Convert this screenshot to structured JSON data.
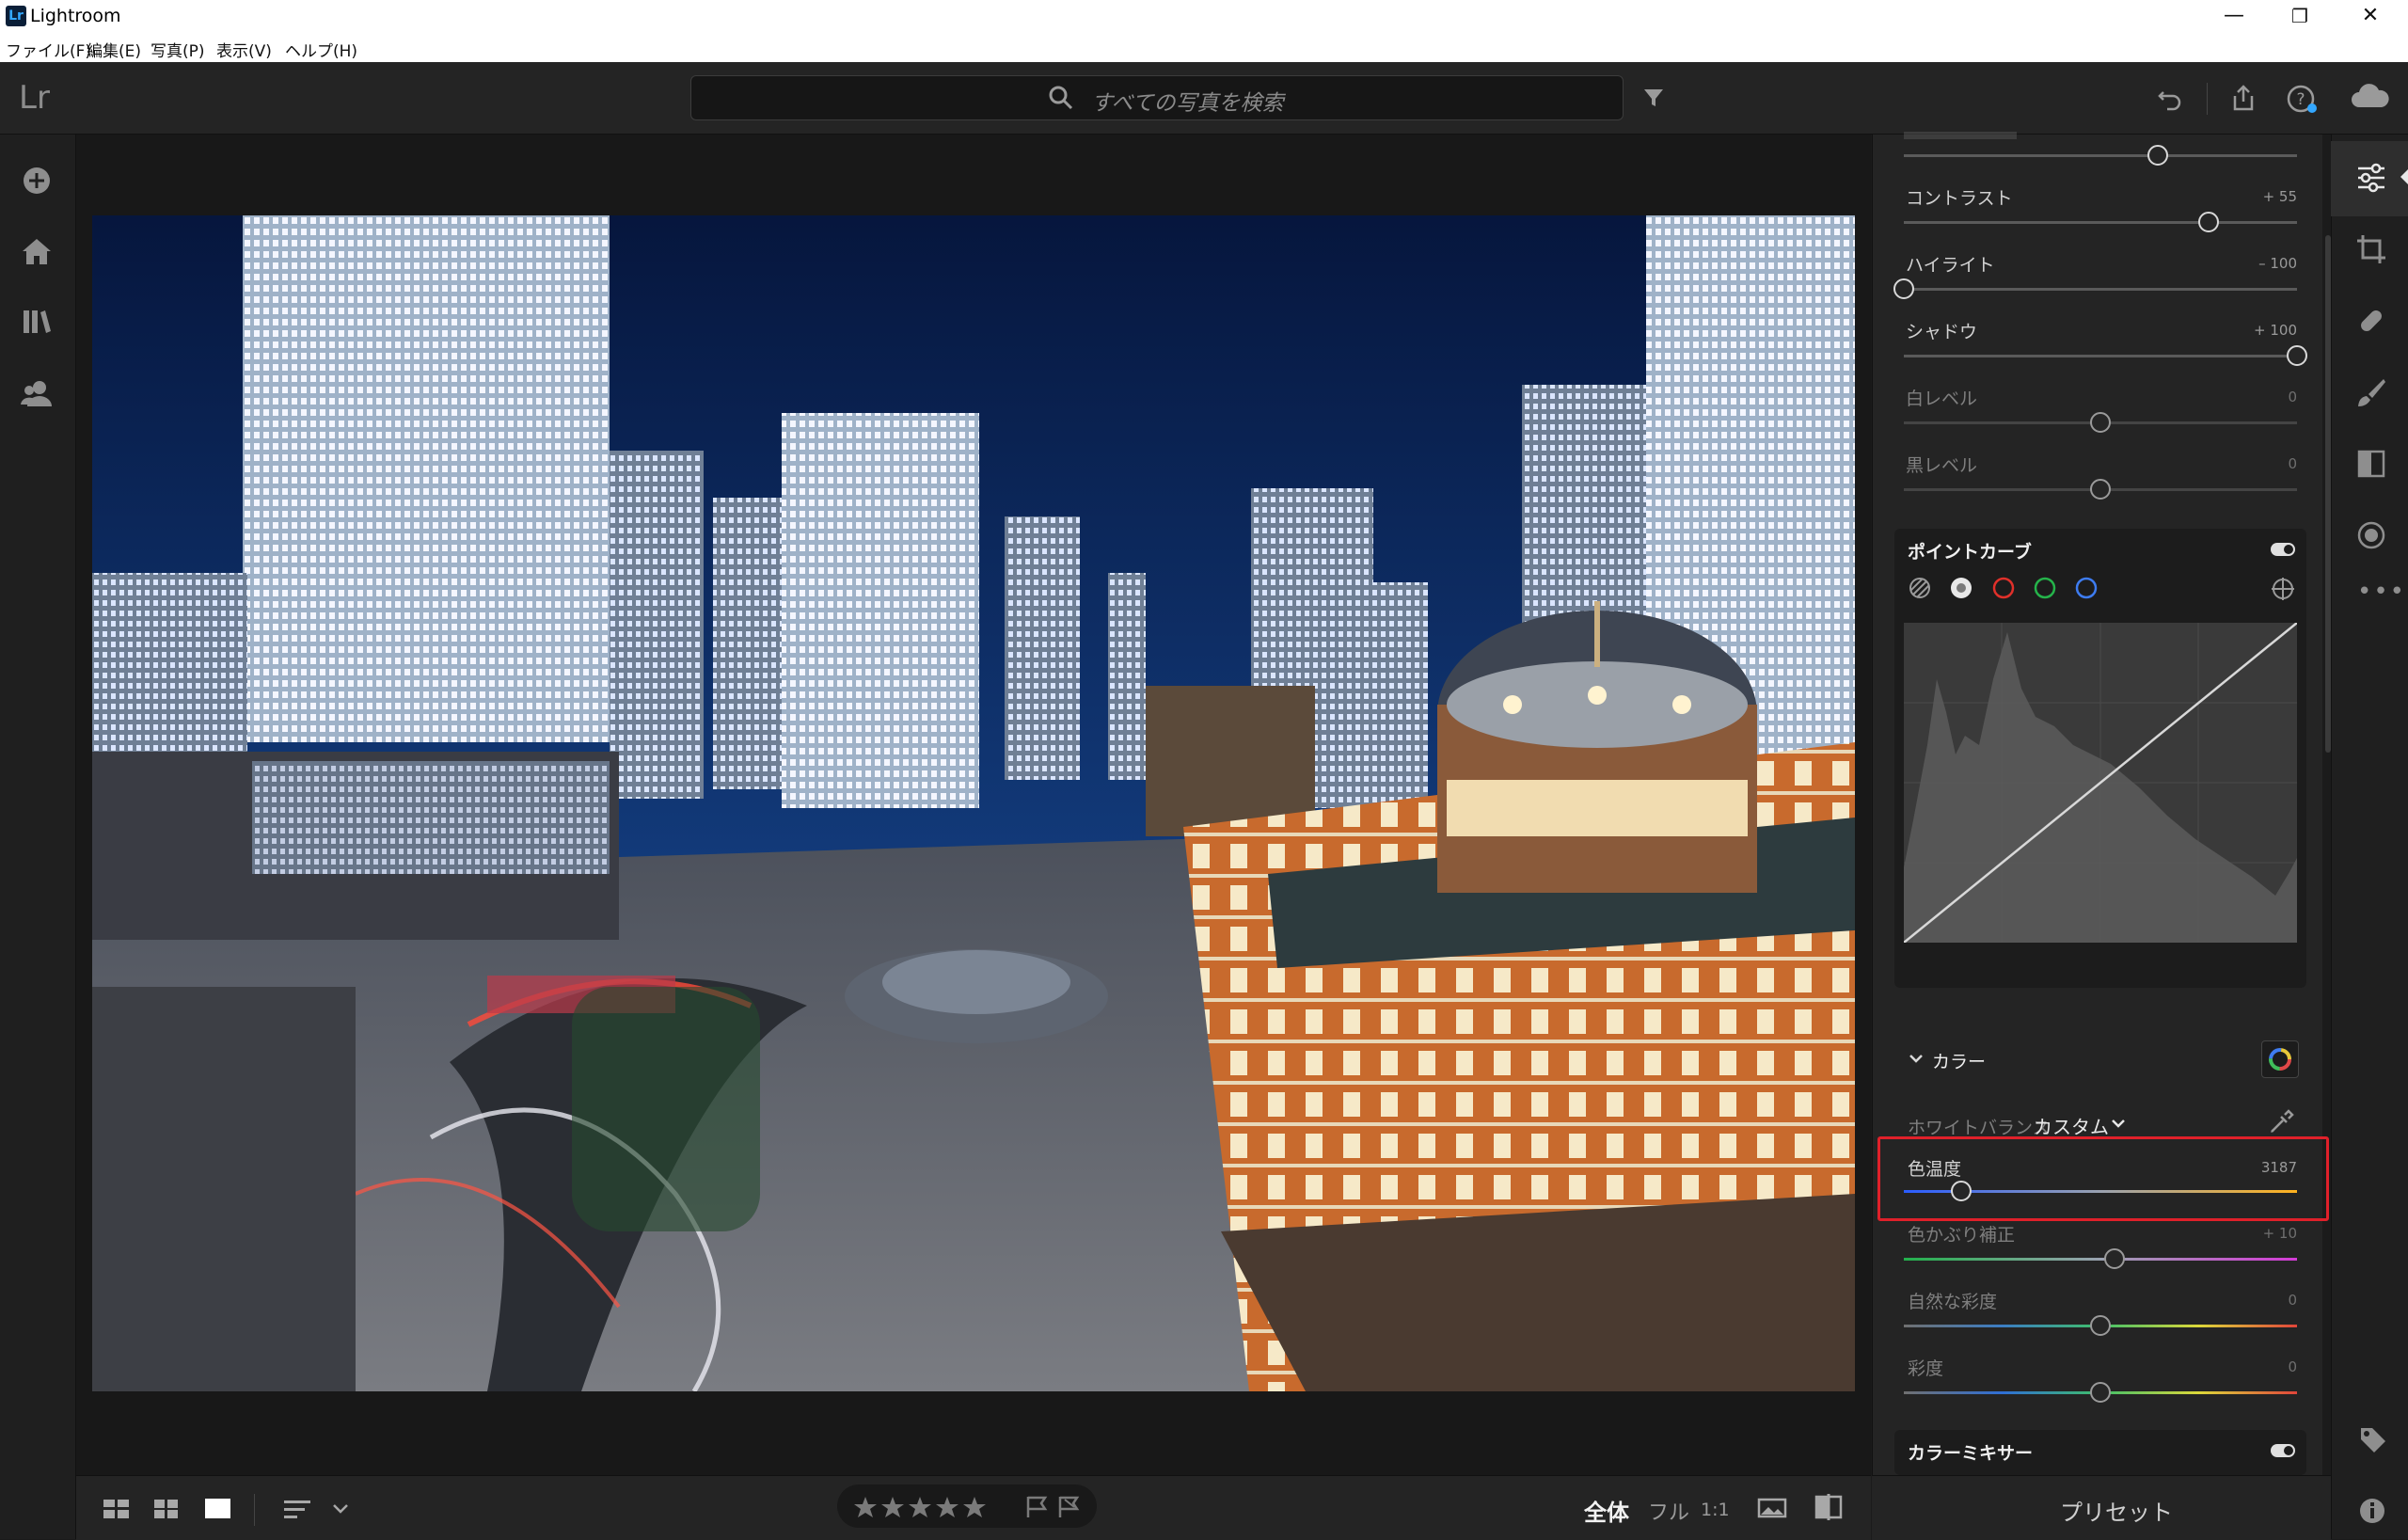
{
  "window": {
    "title": "Lightroom",
    "logo": "Lr",
    "minimize": "—",
    "restore": "❐",
    "close": "✕"
  },
  "menu": [
    "ファイル(F)",
    "編集(E)",
    "写真(P)",
    "表示(V)",
    "ヘルプ(H)"
  ],
  "toolbar": {
    "logo": "Lr",
    "search_placeholder": "すべての写真を検索"
  },
  "edit_panel": {
    "sliders_top": [
      {
        "label": "コントラスト",
        "value": "+ 55",
        "position": 0.775
      },
      {
        "label": "ハイライト",
        "value": "– 100",
        "position": 0.0
      },
      {
        "label": "シャドウ",
        "value": "+ 100",
        "position": 1.0
      },
      {
        "label": "白レベル",
        "value": "0",
        "position": 0.5
      },
      {
        "label": "黒レベル",
        "value": "0",
        "position": 0.5
      }
    ],
    "top_partial_slider_position": 0.645,
    "point_curve": {
      "title": "ポイントカーブ"
    },
    "color": {
      "title": "カラー",
      "white_balance_label": "ホワイトバランス",
      "white_balance_value": "カスタム",
      "temperature": {
        "label": "色温度",
        "value": "3187",
        "position": 0.145
      },
      "tint": {
        "label": "色かぶり補正",
        "value": "+ 10",
        "position": 0.535
      },
      "vibrance": {
        "label": "自然な彩度",
        "value": "0",
        "position": 0.5
      },
      "saturation": {
        "label": "彩度",
        "value": "0",
        "position": 0.5
      }
    },
    "color_mixer": {
      "title": "カラーミキサー"
    }
  },
  "bottom": {
    "view_all": "全体",
    "view_full": "フル",
    "view_1to1": "1:1",
    "presets": "プリセット"
  },
  "colors": {
    "highlight": "#e0202a",
    "accent": "#33a7ff"
  }
}
